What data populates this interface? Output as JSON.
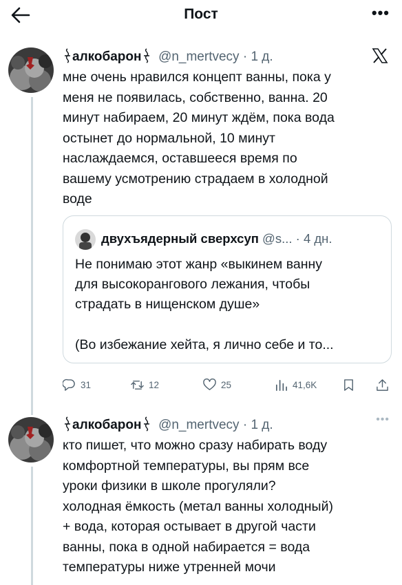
{
  "header": {
    "title": "Пост"
  },
  "main_tweet": {
    "name": "алкобарон",
    "handle": "@n_mertvecy",
    "time": "· 1 д.",
    "text_lines": [
      "мне очень нравился концепт ванны, пока у",
      "меня не появилась, собственно, ванна. 20",
      "минут набираем, 20 минут ждём, пока вода",
      "остынет до нормальной, 10 минут",
      "наслаждаемся, оставшееся время по",
      "вашему усмотрению страдаем в холодной",
      "воде"
    ],
    "quote": {
      "name": "двухъядерный сверхсуп",
      "handle": "@s...",
      "time": "· 4 дн.",
      "text_lines": [
        "Не понимаю этот жанр «выкинем ванну",
        "для высокорангового лежания, чтобы",
        "страдать в нищенском душе»"
      ],
      "text_cont": "(Во избежание хейта, я лично себе и то..."
    },
    "actions": {
      "replies": "31",
      "reposts": "12",
      "likes": "25",
      "views": "41,6K"
    }
  },
  "reply_tweet": {
    "name": "алкобарон",
    "handle": "@n_mertvecy",
    "time": "· 1 д.",
    "text_lines": [
      "кто пишет, что можно сразу набирать воду",
      "комфортной температуры, вы прям все",
      "уроки физики в школе прогуляли?",
      "холодная ёмкость (метал ванны холодный)",
      "+ вода, которая остывает в другой части",
      "ванны, пока в одной набирается = вода",
      "температуры ниже утренней мочи"
    ]
  },
  "icons": [
    "back-arrow-icon",
    "more-icon",
    "x-logo-icon",
    "reply-icon",
    "repost-icon",
    "like-icon",
    "views-icon",
    "bookmark-icon",
    "share-icon"
  ],
  "colors": {
    "text": "#0f1419",
    "muted": "#536471",
    "border": "#cfd9de"
  }
}
